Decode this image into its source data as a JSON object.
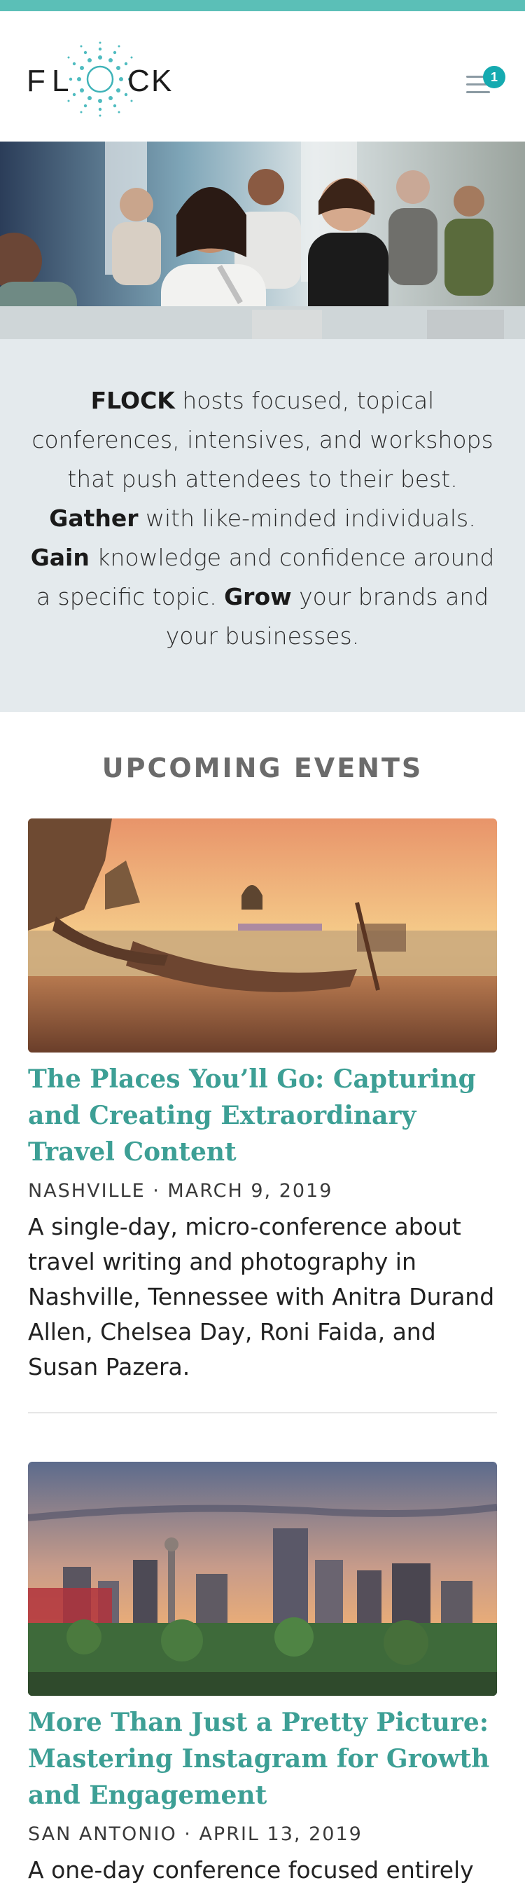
{
  "brand": {
    "logo_text": "FLOCK",
    "accent": "#5bbfb7",
    "title_color": "#3d9f95"
  },
  "header": {
    "menu_icon": "hamburger-icon",
    "badge_count": "1"
  },
  "intro": {
    "brand": "FLOCK",
    "text_1": " hosts focused, topical conferences, intensives, and workshops that push attendees to their best. ",
    "gather": "Gather",
    "text_2": " with like-minded individuals. ",
    "gain": "Gain",
    "text_3": " knowledge and confidence around a specific topic. ",
    "grow": "Grow",
    "text_4": " your brands and your businesses."
  },
  "events": {
    "heading": "UPCOMING EVENTS",
    "items": [
      {
        "title": "The Places You’ll Go: Capturing and Creating Extraordinary Travel Content",
        "meta": "NASHVILLE · MARCH 9, 2019",
        "description": "A single-day, micro-conference about travel writing and photography in Nashville, Tennessee with Anitra Durand Allen, Chelsea Day, Roni Faida, and Susan Pazera."
      },
      {
        "title": "More Than Just a Pretty Picture: Mastering Instagram for Growth and Engagement",
        "meta": "SAN ANTONIO · APRIL 13, 2019",
        "description": "A one-day conference focused entirely on"
      }
    ]
  }
}
